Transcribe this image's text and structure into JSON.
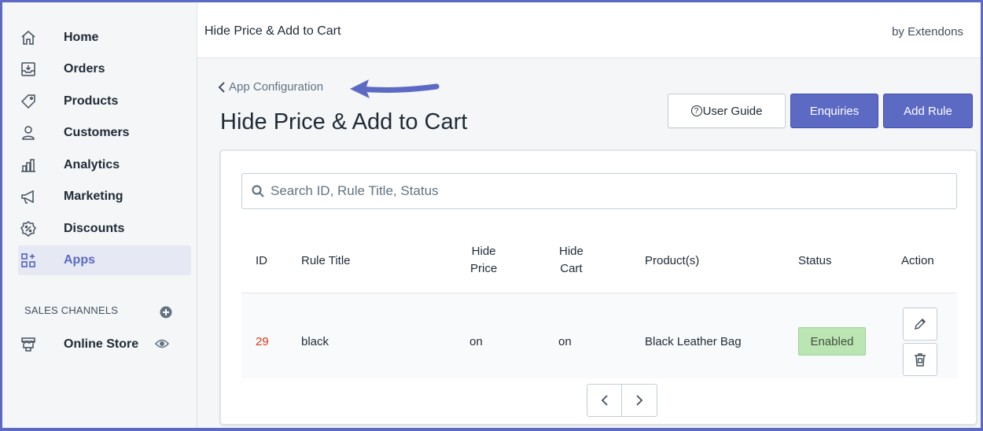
{
  "sidebar": {
    "items": [
      {
        "label": "Home",
        "icon": "home-icon"
      },
      {
        "label": "Orders",
        "icon": "orders-icon"
      },
      {
        "label": "Products",
        "icon": "tag-icon"
      },
      {
        "label": "Customers",
        "icon": "person-icon"
      },
      {
        "label": "Analytics",
        "icon": "bar-chart-icon"
      },
      {
        "label": "Marketing",
        "icon": "megaphone-icon"
      },
      {
        "label": "Discounts",
        "icon": "discount-icon"
      },
      {
        "label": "Apps",
        "icon": "apps-icon",
        "active": true
      }
    ],
    "sales_channels_label": "SALES CHANNELS",
    "online_store_label": "Online Store"
  },
  "topbar": {
    "app_name": "Hide Price & Add to Cart",
    "by": "by Extendons"
  },
  "breadcrumb": "App Configuration",
  "page_title": "Hide Price & Add to Cart",
  "buttons": {
    "user_guide": "User Guide",
    "user_guide_symbol": "?",
    "enquiries": "Enquiries",
    "add_rule": "Add Rule"
  },
  "search": {
    "placeholder": "Search ID, Rule Title, Status"
  },
  "table": {
    "headers": {
      "id": "ID",
      "rule_title": "Rule Title",
      "hide_price_1": "Hide",
      "hide_price_2": "Price",
      "hide_cart_1": "Hide",
      "hide_cart_2": "Cart",
      "products": "Product(s)",
      "status": "Status",
      "action": "Action"
    },
    "rows": [
      {
        "id": "29",
        "rule_title": "black",
        "hide_price": "on",
        "hide_cart": "on",
        "products": "Black Leather Bag",
        "status": "Enabled"
      }
    ]
  },
  "colors": {
    "accent": "#5c6ac4",
    "id_text": "#de3618",
    "status_enabled_bg": "#bbe5b3",
    "annotation_arrow": "#5c6ac4"
  }
}
